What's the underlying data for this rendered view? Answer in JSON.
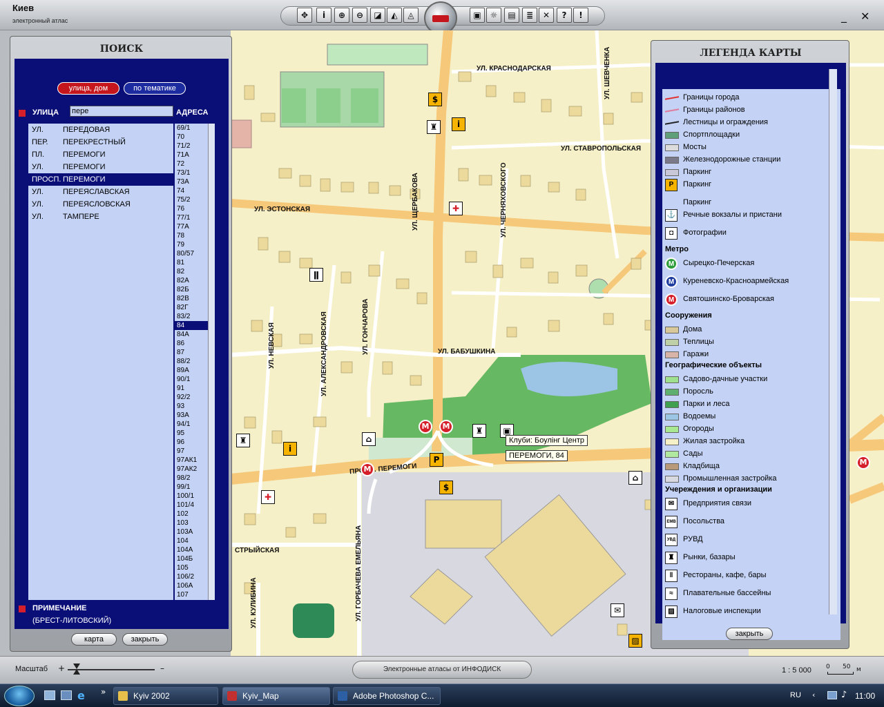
{
  "app": {
    "title": "Киев",
    "subtitle": "электронный атлас"
  },
  "toolbar": {
    "left_icons": [
      "move-icon",
      "info-icon",
      "zoom-in-icon",
      "zoom-out-icon",
      "select-icon",
      "measure-icon",
      "ruler-icon"
    ],
    "right_icons": [
      "fit-icon",
      "lamp-icon",
      "print-icon",
      "list-icon",
      "tools-icon",
      "help-icon",
      "warning-icon"
    ]
  },
  "search": {
    "title": "ПОИСК",
    "tab_street": "улица, дом",
    "tab_topic": "по тематике",
    "street_header": "УЛИЦА",
    "address_header": "АДРЕСА",
    "street_input": "пере",
    "streets": [
      {
        "type": "УЛ.",
        "name": "ПЕРЕДОВАЯ"
      },
      {
        "type": "ПЕР.",
        "name": "ПЕРЕКРЕСТНЫЙ"
      },
      {
        "type": "ПЛ.",
        "name": "ПЕРЕМОГИ"
      },
      {
        "type": "УЛ.",
        "name": "ПЕРЕМОГИ"
      },
      {
        "type": "ПРОСП.",
        "name": "ПЕРЕМОГИ"
      },
      {
        "type": "УЛ.",
        "name": "ПЕРЕЯСЛАВСКАЯ"
      },
      {
        "type": "УЛ.",
        "name": "ПЕРЕЯСЛОВСКАЯ"
      },
      {
        "type": "УЛ.",
        "name": "ТАМПЕРЕ"
      }
    ],
    "selected_street": 4,
    "addresses": [
      "69/1",
      "70",
      "71/2",
      "71А",
      "72",
      "73/1",
      "73А",
      "74",
      "75/2",
      "76",
      "77/1",
      "77А",
      "78",
      "79",
      "80/57",
      "81",
      "82",
      "82А",
      "82Б",
      "82В",
      "82Г",
      "83/2",
      "84",
      "84А",
      "86",
      "87",
      "88/2",
      "89А",
      "90/1",
      "91",
      "92/2",
      "93",
      "93А",
      "94/1",
      "95",
      "96",
      "97",
      "97АК1",
      "97АК2",
      "98/2",
      "99/1",
      "100/1",
      "101/4",
      "102",
      "103",
      "103А",
      "104",
      "104А",
      "104Б",
      "105",
      "106/2",
      "106А",
      "107"
    ],
    "selected_address": 22,
    "note_header": "ПРИМЕЧАНИЕ",
    "note_text": "(БРЕСТ-ЛИТОВСКИЙ)",
    "btn_map": "карта",
    "btn_close": "закрыть"
  },
  "legend": {
    "title": "ЛЕГЕНДА КАРТЫ",
    "items": [
      {
        "type": "line",
        "label": "Границы города",
        "color": "#e03030"
      },
      {
        "type": "line",
        "label": "Границы районов",
        "color": "#e07a9a"
      },
      {
        "type": "line",
        "label": "Лестницы и ограждения",
        "color": "#222222"
      },
      {
        "type": "swatch",
        "label": "Спортплощадки",
        "color": "#5f9f7a"
      },
      {
        "type": "swatch",
        "label": "Мосты",
        "color": "#dcdcdc"
      },
      {
        "type": "swatch",
        "label": "Железнодорожные станции",
        "color": "#7a7a8a"
      },
      {
        "type": "swatch",
        "label": "Паркинг",
        "color": "#c8c8d8"
      },
      {
        "type": "icon",
        "label": "Паркинг",
        "glyph": "P",
        "color": "#f6b400"
      },
      {
        "type": "text",
        "label": "Паркинг"
      },
      {
        "type": "icon",
        "label": "Речные вокзалы и пристани",
        "glyph": "⚓",
        "color": "#ffffff"
      },
      {
        "type": "icon",
        "label": "Фотографии",
        "glyph": "◘",
        "color": "#ffffff"
      },
      {
        "type": "header",
        "label": "Метро"
      },
      {
        "type": "metro",
        "label": "Сырецко-Печерская",
        "color": "#2e9e3a"
      },
      {
        "type": "metro",
        "label": "Куреневско-Красноармейская",
        "color": "#1f3d9e"
      },
      {
        "type": "metro",
        "label": "Святошинско-Броварская",
        "color": "#d5202b"
      },
      {
        "type": "header",
        "label": "Сооружения"
      },
      {
        "type": "swatch",
        "label": "Дома",
        "color": "#d8c89a"
      },
      {
        "type": "swatch",
        "label": "Теплицы",
        "color": "#bfd0a8"
      },
      {
        "type": "swatch",
        "label": "Гаражи",
        "color": "#d8b4a8"
      },
      {
        "type": "header",
        "label": "Географические объекты"
      },
      {
        "type": "swatch",
        "label": "Садово-дачные участки",
        "color": "#9fe08f"
      },
      {
        "type": "swatch",
        "label": "Поросль",
        "color": "#5fb070"
      },
      {
        "type": "swatch",
        "label": "Парки и леса",
        "color": "#3fa050"
      },
      {
        "type": "swatch",
        "label": "Водоемы",
        "color": "#9cc4e4"
      },
      {
        "type": "swatch",
        "label": "Огороды",
        "color": "#a8e890"
      },
      {
        "type": "swatch",
        "label": "Жилая застройка",
        "color": "#f6f0c8"
      },
      {
        "type": "swatch",
        "label": "Сады",
        "color": "#b0e8a0"
      },
      {
        "type": "swatch",
        "label": "Кладбища",
        "color": "#b89a7a"
      },
      {
        "type": "swatch",
        "label": "Промышленная застройка",
        "color": "#d8d8e0"
      },
      {
        "type": "header",
        "label": "Учереждения и организации"
      },
      {
        "type": "icon",
        "label": "Предприятия связи",
        "glyph": "✉",
        "color": "#ffffff"
      },
      {
        "type": "icon",
        "label": "Посольства",
        "glyph": "EMB",
        "color": "#ffffff"
      },
      {
        "type": "icon",
        "label": "РУВД",
        "glyph": "УВД",
        "color": "#ffffff"
      },
      {
        "type": "icon",
        "label": "Рынки, базары",
        "glyph": "♜",
        "color": "#ffffff"
      },
      {
        "type": "icon",
        "label": "Рестораны, кафе, бары",
        "glyph": "ǁ",
        "color": "#ffffff"
      },
      {
        "type": "icon",
        "label": "Плавательные бассейны",
        "glyph": "≈",
        "color": "#ffffff"
      },
      {
        "type": "icon",
        "label": "Налоговые инспекции",
        "glyph": "▨",
        "color": "#ffffff"
      }
    ],
    "btn_close": "закрыть"
  },
  "map": {
    "streets": [
      "УЛ. КРАСНОДАРСКАЯ",
      "УЛ. СТАВРОПОЛЬСКАЯ",
      "УЛ. ЭСТОНСКАЯ",
      "УЛ. ЩЕРБАКОВА",
      "УЛ. ЧЕРНЯХОВСКОГО",
      "УЛ. БАБУШКИНА",
      "УЛ. НЕВСКАЯ",
      "УЛ. АЛЕКСАНДРОВСКАЯ",
      "УЛ. ГОНЧАРОВА",
      "ПРОСП. ПЕРЕМОГИ",
      "СТРЫЙСКАЯ",
      "УЛ. КУЛИБИНА",
      "УЛ. ГОРБАЧЕВА ЕМЕЛЬЯНА",
      "УЛ. ШЕВЧЕНКА"
    ],
    "tooltip_title": "Клуби: Боулінг Центр",
    "tooltip_address": "ПЕРЕМОГИ, 84"
  },
  "status": {
    "scale_label": "Масштаб",
    "brand": "Электронные атласы от ИНФОДИСК",
    "ratio": "1 : 5 000",
    "bar_start": "0",
    "bar_end": "50",
    "bar_unit": "м"
  },
  "taskbar": {
    "tasks": [
      {
        "label": "Kyiv 2002",
        "color": "#e6c04a"
      },
      {
        "label": "Kyiv_Map",
        "color": "#c43030"
      },
      {
        "label": "Adobe Photoshop C...",
        "color": "#2d5fa5"
      }
    ],
    "lang": "RU",
    "time": "11:00"
  }
}
